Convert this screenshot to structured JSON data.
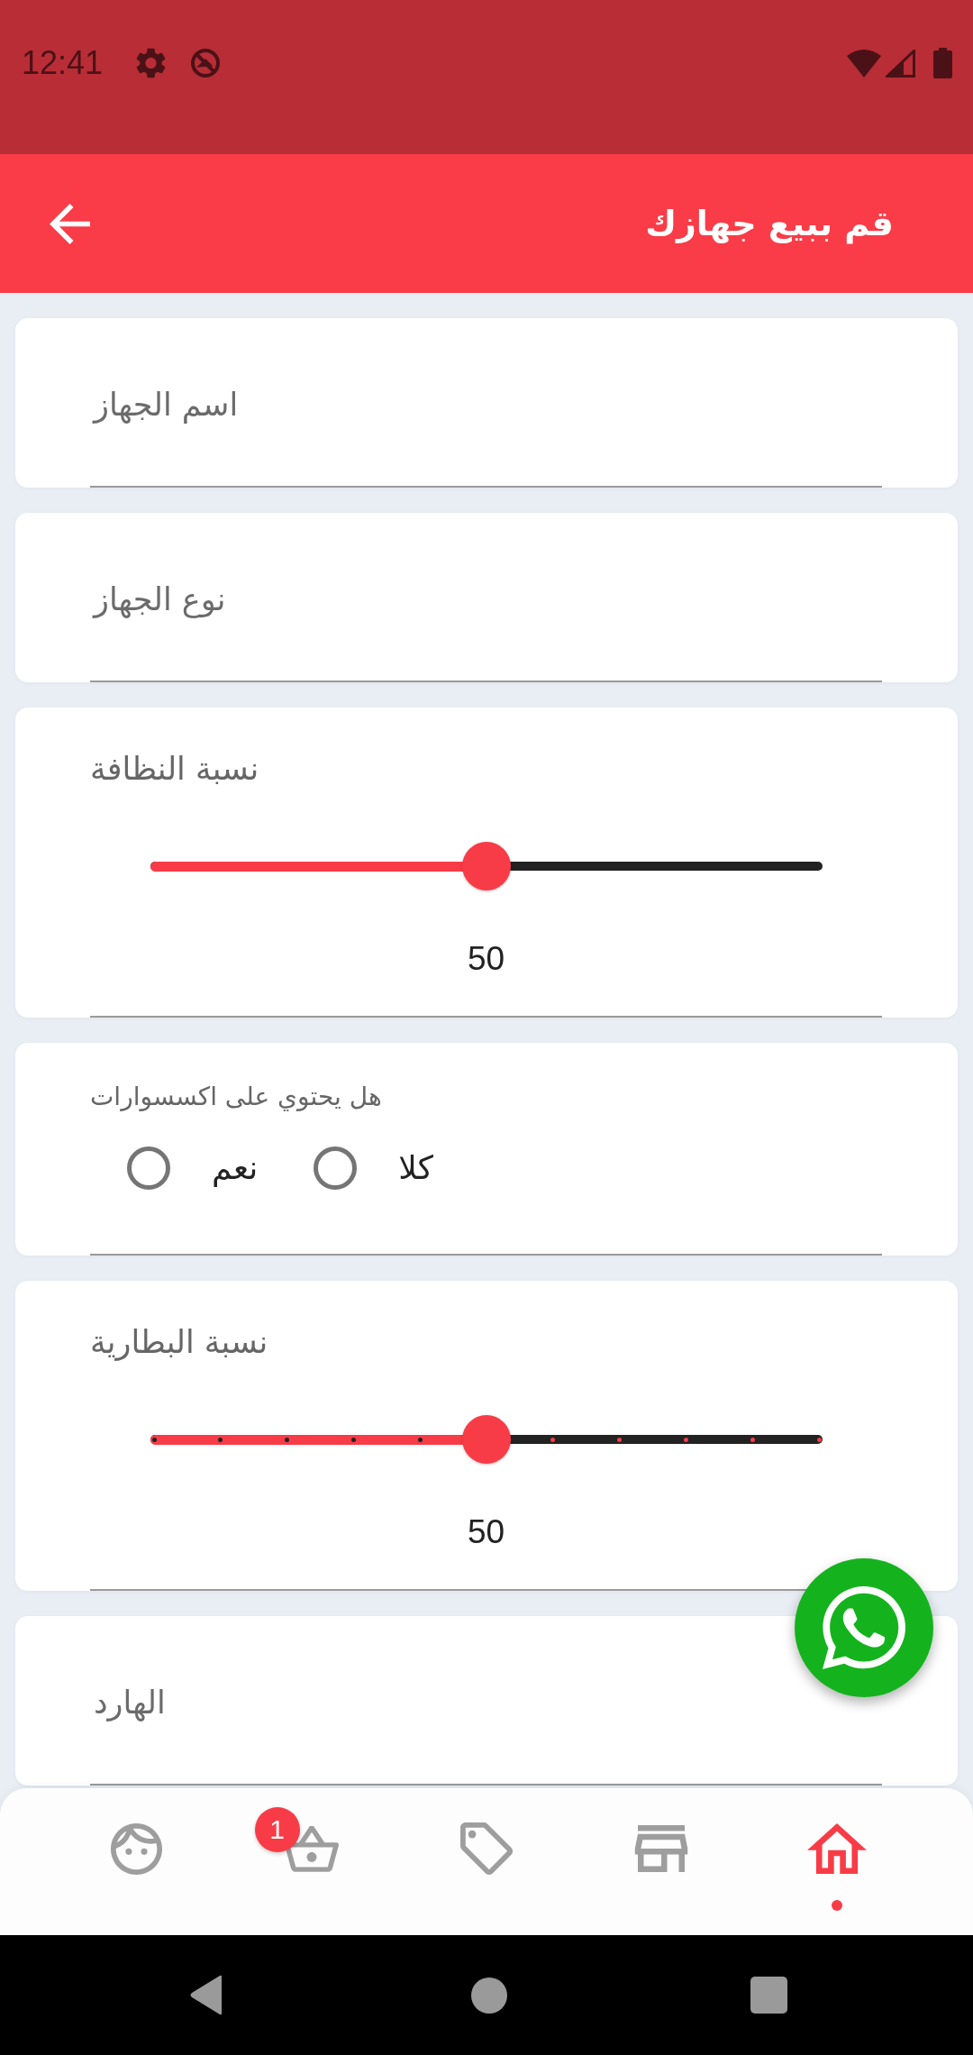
{
  "status_bar": {
    "time": "12:41"
  },
  "app_bar": {
    "title": "قم ببيع جهازك"
  },
  "form": [
    {
      "kind": "text",
      "placeholder": "اسم الجهاز"
    },
    {
      "kind": "text",
      "placeholder": "نوع الجهاز"
    },
    {
      "kind": "slider",
      "label": "نسبة النظافة",
      "level": 0.5,
      "reading": "50",
      "stepped": false
    },
    {
      "kind": "radio",
      "label": "هل يحتوي على اكسسوارات",
      "options": [
        {
          "label": "كلا",
          "selected": false
        },
        {
          "label": "نعم",
          "selected": false
        }
      ]
    },
    {
      "kind": "slider",
      "label": "نسبة البطارية",
      "level": 0.5,
      "reading": "50",
      "stepped": true
    },
    {
      "kind": "text",
      "placeholder": "الهارد"
    }
  ],
  "bottom_nav": {
    "items": [
      {
        "kind": "face",
        "selected": false
      },
      {
        "kind": "basket",
        "selected": false,
        "badge": "1"
      },
      {
        "kind": "tag",
        "selected": false
      },
      {
        "kind": "store",
        "selected": false
      },
      {
        "kind": "home",
        "selected": true
      }
    ]
  }
}
